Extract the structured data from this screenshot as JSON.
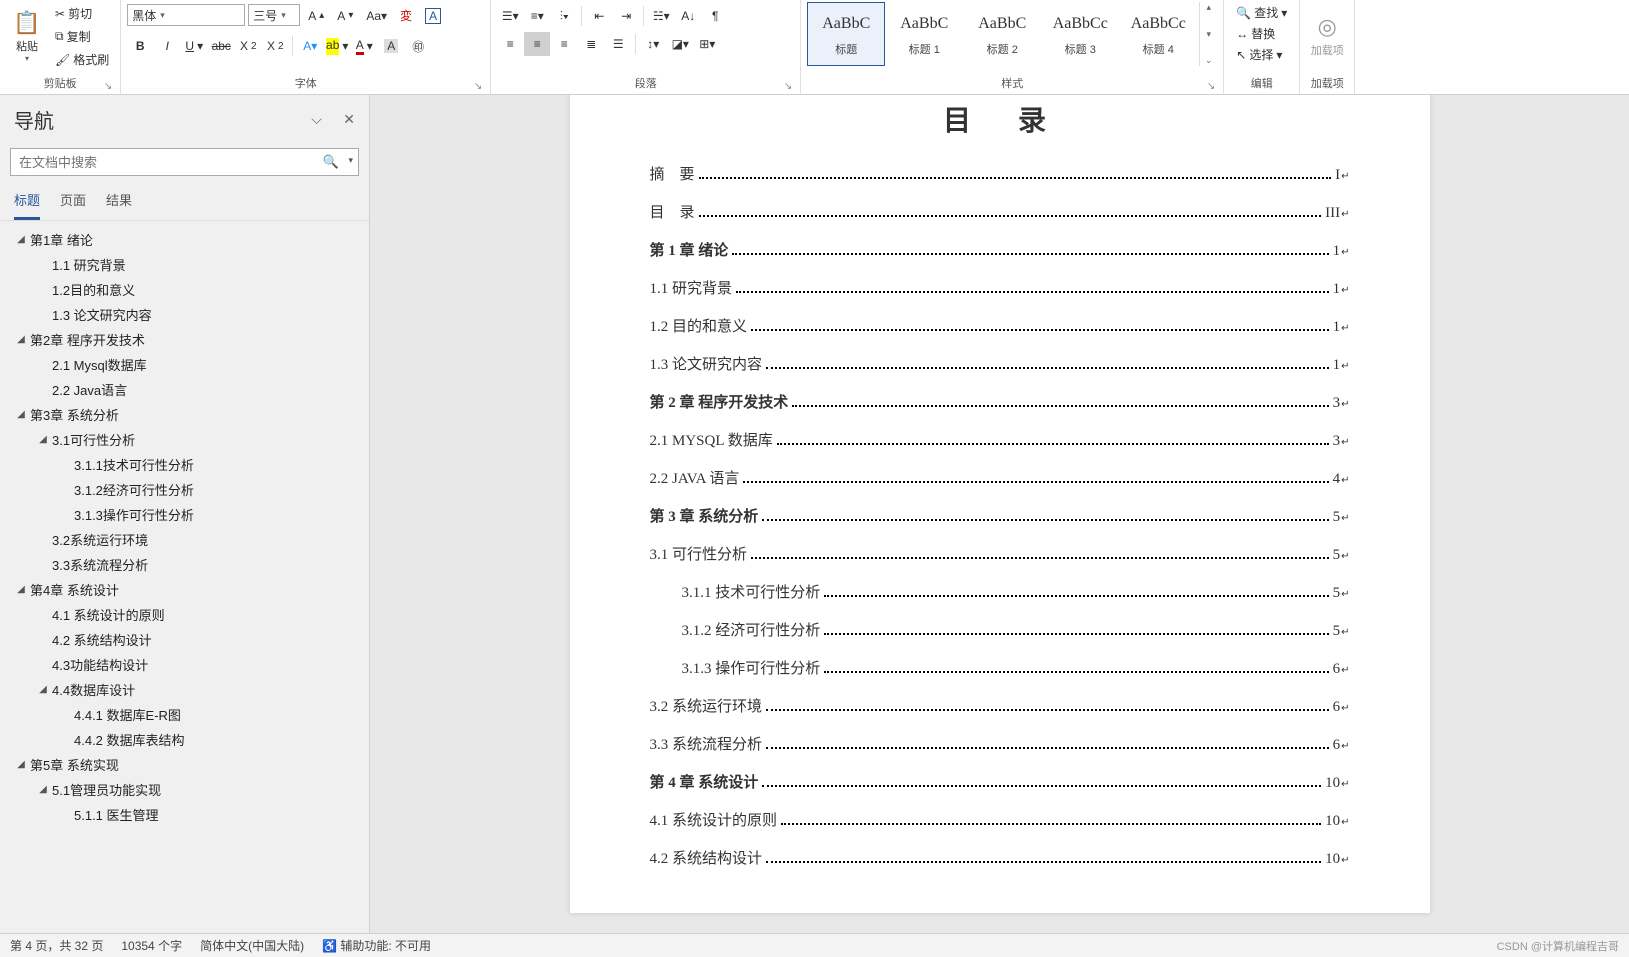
{
  "ribbon": {
    "clipboard": {
      "paste": "粘贴",
      "cut": "剪切",
      "copy": "复制",
      "format_painter": "格式刷",
      "group_label": "剪贴板"
    },
    "font": {
      "font_name": "黑体",
      "font_size": "三号",
      "group_label": "字体"
    },
    "paragraph": {
      "group_label": "段落"
    },
    "styles": {
      "items": [
        {
          "preview": "AaBbC",
          "name": "标题",
          "selected": true
        },
        {
          "preview": "AaBbC",
          "name": "标题 1"
        },
        {
          "preview": "AaBbC",
          "name": "标题 2"
        },
        {
          "preview": "AaBbCc",
          "name": "标题 3"
        },
        {
          "preview": "AaBbCc",
          "name": "标题 4"
        }
      ],
      "group_label": "样式"
    },
    "editing": {
      "find": "查找",
      "replace": "替换",
      "select": "选择",
      "group_label": "编辑"
    },
    "addins": {
      "label": "加载项",
      "group_label": "加载项"
    }
  },
  "nav": {
    "title": "导航",
    "search_placeholder": "在文档中搜索",
    "tabs": {
      "headings": "标题",
      "pages": "页面",
      "results": "结果"
    },
    "tree": [
      {
        "lvl": 1,
        "caret": true,
        "label": "第1章 绪论"
      },
      {
        "lvl": 2,
        "caret": false,
        "label": "1.1 研究背景"
      },
      {
        "lvl": 2,
        "caret": false,
        "label": "1.2目的和意义"
      },
      {
        "lvl": 2,
        "caret": false,
        "label": "1.3 论文研究内容"
      },
      {
        "lvl": 1,
        "caret": true,
        "label": "第2章 程序开发技术"
      },
      {
        "lvl": 2,
        "caret": false,
        "label": "2.1 Mysql数据库"
      },
      {
        "lvl": 2,
        "caret": false,
        "label": "2.2 Java语言"
      },
      {
        "lvl": 1,
        "caret": true,
        "label": "第3章 系统分析"
      },
      {
        "lvl": 2,
        "caret": true,
        "label": "3.1可行性分析"
      },
      {
        "lvl": 3,
        "caret": false,
        "label": "3.1.1技术可行性分析"
      },
      {
        "lvl": 3,
        "caret": false,
        "label": "3.1.2经济可行性分析"
      },
      {
        "lvl": 3,
        "caret": false,
        "label": "3.1.3操作可行性分析"
      },
      {
        "lvl": 2,
        "caret": false,
        "label": "3.2系统运行环境"
      },
      {
        "lvl": 2,
        "caret": false,
        "label": "3.3系统流程分析"
      },
      {
        "lvl": 1,
        "caret": true,
        "label": "第4章 系统设计"
      },
      {
        "lvl": 2,
        "caret": false,
        "label": "4.1 系统设计的原则"
      },
      {
        "lvl": 2,
        "caret": false,
        "label": "4.2 系统结构设计"
      },
      {
        "lvl": 2,
        "caret": false,
        "label": "4.3功能结构设计"
      },
      {
        "lvl": 2,
        "caret": true,
        "label": "4.4数据库设计"
      },
      {
        "lvl": 3,
        "caret": false,
        "label": "4.4.1 数据库E-R图"
      },
      {
        "lvl": 3,
        "caret": false,
        "label": "4.4.2 数据库表结构"
      },
      {
        "lvl": 1,
        "caret": true,
        "label": "第5章 系统实现"
      },
      {
        "lvl": 2,
        "caret": true,
        "label": "5.1管理员功能实现"
      },
      {
        "lvl": 3,
        "caret": false,
        "label": "5.1.1 医生管理"
      }
    ]
  },
  "document": {
    "toc_title": "目 录",
    "entries": [
      {
        "indent": 1,
        "bold": false,
        "text": "摘　要",
        "page": "I"
      },
      {
        "indent": 1,
        "bold": false,
        "text": "目　录",
        "page": "III"
      },
      {
        "indent": 1,
        "bold": true,
        "text": "第 1 章  绪论",
        "page": "1"
      },
      {
        "indent": 2,
        "bold": false,
        "text": "1.1  研究背景",
        "page": "1"
      },
      {
        "indent": 2,
        "bold": false,
        "text": "1.2  目的和意义",
        "page": "1"
      },
      {
        "indent": 2,
        "bold": false,
        "text": "1.3  论文研究内容",
        "page": "1"
      },
      {
        "indent": 1,
        "bold": true,
        "text": "第 2 章  程序开发技术",
        "page": "3"
      },
      {
        "indent": 2,
        "bold": false,
        "text": "2.1 MYSQL 数据库",
        "page": "3"
      },
      {
        "indent": 2,
        "bold": false,
        "text": "2.2 JAVA 语言",
        "page": "4"
      },
      {
        "indent": 1,
        "bold": true,
        "text": "第 3 章  系统分析",
        "page": "5"
      },
      {
        "indent": 2,
        "bold": false,
        "text": "3.1 可行性分析",
        "page": "5"
      },
      {
        "indent": 3,
        "bold": false,
        "text": "3.1.1 技术可行性分析",
        "page": "5"
      },
      {
        "indent": 3,
        "bold": false,
        "text": "3.1.2 经济可行性分析",
        "page": "5"
      },
      {
        "indent": 3,
        "bold": false,
        "text": "3.1.3 操作可行性分析",
        "page": "6"
      },
      {
        "indent": 2,
        "bold": false,
        "text": "3.2 系统运行环境",
        "page": "6"
      },
      {
        "indent": 2,
        "bold": false,
        "text": "3.3 系统流程分析",
        "page": "6"
      },
      {
        "indent": 1,
        "bold": true,
        "text": "第 4 章  系统设计",
        "page": "10"
      },
      {
        "indent": 2,
        "bold": false,
        "text": "4.1 系统设计的原则",
        "page": "10"
      },
      {
        "indent": 2,
        "bold": false,
        "text": "4.2 系统结构设计",
        "page": "10"
      }
    ]
  },
  "status": {
    "page": "第 4 页，共 32 页",
    "words": "10354 个字",
    "lang": "简体中文(中国大陆)",
    "accessibility": "辅助功能: 不可用",
    "watermark": "CSDN @计算机编程吉哥"
  }
}
